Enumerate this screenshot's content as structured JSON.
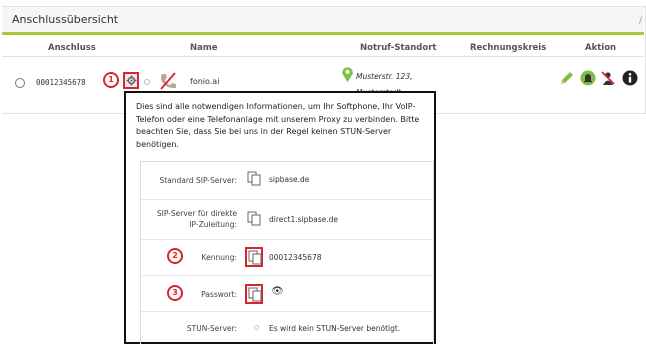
{
  "panel": {
    "title": "Anschlussübersicht",
    "edit_mark": "/"
  },
  "table": {
    "headers": [
      "Anschluss",
      "Name",
      "Notruf-Standort",
      "Rechnungskreis",
      "Aktion"
    ],
    "row": {
      "number": "00012345678",
      "step1": "1",
      "name": "fonio.ai",
      "address_line1": "Musterstr. 123,",
      "address_line2": "Musterstadt"
    }
  },
  "popup": {
    "intro": "Dies sind alle notwendigen Informationen, um Ihr Softphone, Ihr VoIP-Telefon oder eine Telefonanlage mit unserem Proxy zu verbinden. Bitte beachten Sie, dass Sie bei uns in der Regel keinen STUN-Server benötigen.",
    "fields": [
      {
        "label": "Standard SIP-Server:",
        "value": "sipbase.de"
      },
      {
        "label_line1": "SIP-Server für direkte",
        "label_line2": "IP-Zuleitung:",
        "value": "direct1.sipbase.de"
      },
      {
        "step": "2",
        "label": "Kennung:",
        "value": "00012345678"
      },
      {
        "step": "3",
        "label": "Passwort:",
        "value": "👁"
      },
      {
        "label": "STUN-Server:",
        "value": "Es wird kein STUN-Server benötigt."
      }
    ]
  },
  "colors": {
    "accent_green": "#a6c93b",
    "highlight_red": "#d9232d",
    "pin_green": "#7cc242"
  },
  "icons": [
    "gear-icon",
    "phone-crossed-icon",
    "location-pin-icon",
    "pencil-icon",
    "bell-icon",
    "block-icon",
    "info-icon",
    "copy-icon",
    "eye-icon"
  ]
}
